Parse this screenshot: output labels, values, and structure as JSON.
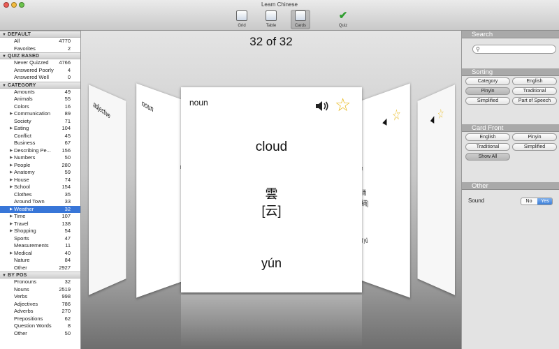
{
  "window": {
    "title": "Learn Chinese"
  },
  "toolbar": {
    "items": [
      {
        "label": "Grid",
        "icon": "grid-icon"
      },
      {
        "label": "Table",
        "icon": "table-icon"
      },
      {
        "label": "Cards",
        "icon": "cards-icon",
        "active": true
      },
      {
        "label": "Quiz",
        "icon": "checkmark-icon"
      }
    ]
  },
  "sidebar": {
    "sections": [
      {
        "title": "DEFAULT",
        "items": [
          {
            "label": "All",
            "count": "4770"
          },
          {
            "label": "Favorites",
            "count": "2"
          }
        ]
      },
      {
        "title": "QUIZ BASED",
        "items": [
          {
            "label": "Never Quizzed",
            "count": "4766"
          },
          {
            "label": "Answered Poorly",
            "count": "4"
          },
          {
            "label": "Answered Well",
            "count": "0"
          }
        ]
      },
      {
        "title": "CATEGORY",
        "items": [
          {
            "label": "Amounts",
            "count": "49"
          },
          {
            "label": "Animals",
            "count": "55"
          },
          {
            "label": "Colors",
            "count": "16"
          },
          {
            "label": "Communication",
            "count": "89",
            "expandable": true
          },
          {
            "label": "Society",
            "count": "71"
          },
          {
            "label": "Eating",
            "count": "104",
            "expandable": true
          },
          {
            "label": "Conflict",
            "count": "45"
          },
          {
            "label": "Business",
            "count": "67"
          },
          {
            "label": "Describing Pe...",
            "count": "156",
            "expandable": true
          },
          {
            "label": "Numbers",
            "count": "50",
            "expandable": true
          },
          {
            "label": "People",
            "count": "280",
            "expandable": true
          },
          {
            "label": "Anatomy",
            "count": "59",
            "expandable": true
          },
          {
            "label": "House",
            "count": "74",
            "expandable": true
          },
          {
            "label": "School",
            "count": "154",
            "expandable": true
          },
          {
            "label": "Clothes",
            "count": "35"
          },
          {
            "label": "Around Town",
            "count": "33"
          },
          {
            "label": "Weather",
            "count": "32",
            "expandable": true,
            "selected": true
          },
          {
            "label": "Time",
            "count": "107",
            "expandable": true
          },
          {
            "label": "Travel",
            "count": "138",
            "expandable": true
          },
          {
            "label": "Shopping",
            "count": "54",
            "expandable": true
          },
          {
            "label": "Sports",
            "count": "47"
          },
          {
            "label": "Measurements",
            "count": "11"
          },
          {
            "label": "Medical",
            "count": "40",
            "expandable": true
          },
          {
            "label": "Nature",
            "count": "84"
          },
          {
            "label": "Other",
            "count": "2927"
          }
        ]
      },
      {
        "title": "BY POS",
        "items": [
          {
            "label": "Pronouns",
            "count": "32"
          },
          {
            "label": "Nouns",
            "count": "2519"
          },
          {
            "label": "Verbs",
            "count": "998"
          },
          {
            "label": "Adjectives",
            "count": "786"
          },
          {
            "label": "Adverbs",
            "count": "270"
          },
          {
            "label": "Prepositions",
            "count": "62"
          },
          {
            "label": "Question Words",
            "count": "8"
          },
          {
            "label": "Other",
            "count": "50"
          }
        ]
      }
    ]
  },
  "main": {
    "counter": "32 of 32",
    "card": {
      "pos": "noun",
      "english": "cloud",
      "traditional": "雲",
      "simplified": "[云]",
      "pinyin": "yún"
    },
    "left_cards": [
      {
        "pos": "adjective"
      },
      {
        "pos": "noun",
        "frags": [
          "ra",
          "雨",
          "y"
        ]
      }
    ],
    "right_cards": [
      {
        "frags": [
          "rm",
          "暴雨",
          "[暴雨]",
          "ng yǔ"
        ]
      },
      {}
    ]
  },
  "right_panel": {
    "search": {
      "title": "Search",
      "value": ""
    },
    "sorting": {
      "title": "Sorting",
      "options": [
        {
          "label": "Category"
        },
        {
          "label": "English"
        },
        {
          "label": "Pinyin",
          "selected": true
        },
        {
          "label": "Traditional"
        },
        {
          "label": "Simplified"
        },
        {
          "label": "Part of Speech"
        }
      ]
    },
    "card_front": {
      "title": "Card Front",
      "options": [
        {
          "label": "English"
        },
        {
          "label": "Pinyin"
        },
        {
          "label": "Traditional"
        },
        {
          "label": "Simplified"
        },
        {
          "label": "Show All",
          "selected": true
        }
      ]
    },
    "other": {
      "title": "Other",
      "sound_label": "Sound",
      "no_label": "No",
      "yes_label": "Yes",
      "sound": "Yes"
    }
  },
  "colors": {
    "selection": "#3876d8",
    "star": "#e8b91a",
    "quiz_check": "#2e9d2e"
  }
}
